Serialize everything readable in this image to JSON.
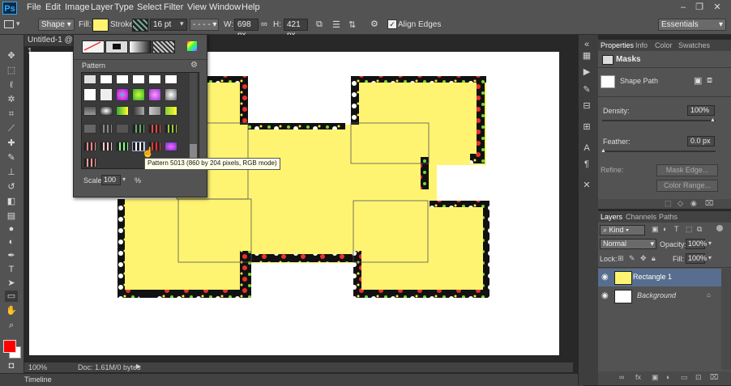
{
  "app": {
    "logo": "Ps"
  },
  "menu": [
    "File",
    "Edit",
    "Image",
    "Layer",
    "Type",
    "Select",
    "Filter",
    "View",
    "Window",
    "Help"
  ],
  "options": {
    "tool_mode": "Shape",
    "fill_label": "Fill:",
    "stroke_label": "Stroke:",
    "stroke_width": "16 pt",
    "w_label": "W:",
    "w_value": "698 px",
    "h_label": "H:",
    "h_value": "421 px",
    "align_edges": "Align Edges",
    "workspace": "Essentials",
    "fill_color": "#fff471"
  },
  "document": {
    "tab": "Untitled-1 @ 1",
    "zoom": "100%",
    "doc_info": "Doc: 1.61M/0 bytes"
  },
  "timeline": {
    "label": "Timeline"
  },
  "pattern_picker": {
    "section": "Pattern",
    "scale_label": "Scale:",
    "scale_value": "100",
    "scale_unit": "%",
    "tooltip": "Pattern 5013 (860 by 204 pixels, RGB mode)"
  },
  "properties": {
    "tabs": [
      "Properties",
      "Info",
      "Color",
      "Swatches"
    ],
    "masks_title": "Masks",
    "shape_path": "Shape Path",
    "density_label": "Density:",
    "density_value": "100%",
    "feather_label": "Feather:",
    "feather_value": "0.0 px",
    "refine_label": "Refine:",
    "mask_edge": "Mask Edge...",
    "color_range": "Color Range..."
  },
  "layers": {
    "tabs": [
      "Layers",
      "Channels",
      "Paths"
    ],
    "kind": "Kind",
    "blend_mode": "Normal",
    "opacity_label": "Opacity:",
    "opacity_value": "100%",
    "lock_label": "Lock:",
    "fill_label": "Fill:",
    "fill_value": "100%",
    "items": [
      "Rectangle 1",
      "Background"
    ]
  },
  "colors": {
    "foreground": "#ff0000",
    "background": "#ffffff"
  }
}
